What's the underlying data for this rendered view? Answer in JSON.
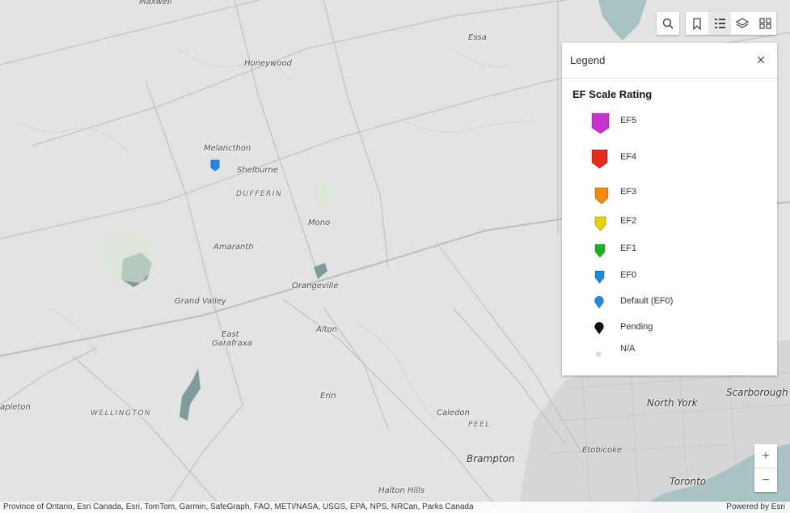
{
  "map": {
    "places": [
      {
        "name": "Maxwell",
        "kind": "town"
      },
      {
        "name": "Essa",
        "kind": "town"
      },
      {
        "name": "Honeywood",
        "kind": "town"
      },
      {
        "name": "Melancthon",
        "kind": "town"
      },
      {
        "name": "Shelburne",
        "kind": "town"
      },
      {
        "name": "DUFFERIN",
        "kind": "county"
      },
      {
        "name": "Mono",
        "kind": "town"
      },
      {
        "name": "Amaranth",
        "kind": "town"
      },
      {
        "name": "Orangeville",
        "kind": "town"
      },
      {
        "name": "Grand Valley",
        "kind": "town"
      },
      {
        "name": "Alton",
        "kind": "town"
      },
      {
        "name": "East",
        "kind": "town"
      },
      {
        "name": "Garafraxa",
        "kind": "town"
      },
      {
        "name": "apleton",
        "kind": "town"
      },
      {
        "name": "WELLINGTON",
        "kind": "county"
      },
      {
        "name": "Erin",
        "kind": "town"
      },
      {
        "name": "Caledon",
        "kind": "town"
      },
      {
        "name": "PEEL",
        "kind": "county"
      },
      {
        "name": "Etobicoke",
        "kind": "town"
      },
      {
        "name": "North York",
        "kind": "city"
      },
      {
        "name": "Scarborough",
        "kind": "city"
      },
      {
        "name": "Brampton",
        "kind": "city"
      },
      {
        "name": "Toronto",
        "kind": "city"
      },
      {
        "name": "Halton Hills",
        "kind": "town"
      }
    ],
    "marker": {
      "rating": "EF0",
      "color": "#1e88e5"
    }
  },
  "toolbar": {
    "search_icon": "search-icon",
    "bookmarks_icon": "bookmark-icon",
    "legend_icon": "legend-list-icon",
    "layers_icon": "layers-icon",
    "basemap_icon": "basemap-gallery-icon"
  },
  "legend": {
    "title": "Legend",
    "close_icon": "close-icon",
    "layer_title": "EF Scale Rating",
    "items": [
      {
        "label": "EF5",
        "color": "#c832d2"
      },
      {
        "label": "EF4",
        "color": "#e8291c"
      },
      {
        "label": "EF3",
        "color": "#f08a10"
      },
      {
        "label": "EF2",
        "color": "#e8d400"
      },
      {
        "label": "EF1",
        "color": "#19b419"
      },
      {
        "label": "EF0",
        "color": "#1e88e5"
      },
      {
        "label": "Default (EF0)",
        "color": "#1e88e5"
      },
      {
        "label": "Pending",
        "color": "#111111"
      },
      {
        "label": "N/A",
        "color": "#dddddd"
      }
    ]
  },
  "zoom": {
    "in_label": "+",
    "out_label": "−"
  },
  "attribution": {
    "sources": "Province of Ontario, Esri Canada, Esri, TomTom, Garmin, SafeGraph, FAO, METI/NASA, USGS, EPA, NPS, NRCan, Parks Canada",
    "powered_by": "Powered by Esri"
  }
}
